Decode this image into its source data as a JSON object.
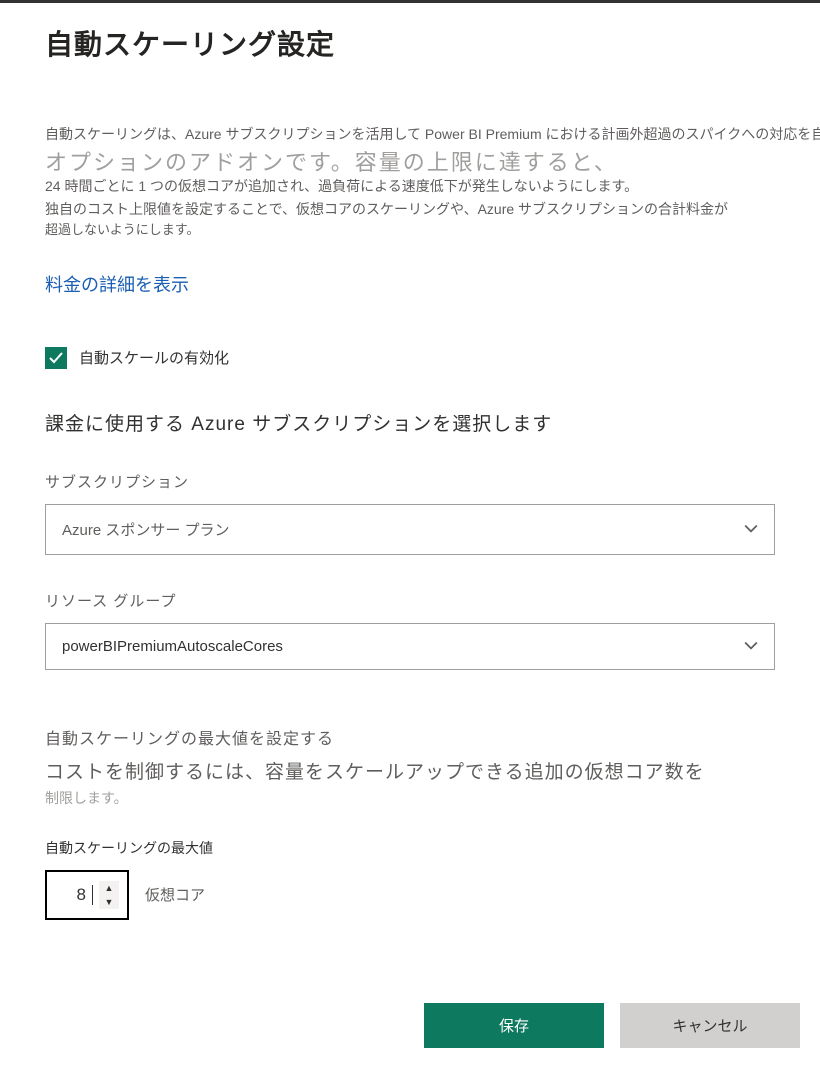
{
  "header": {
    "title": "自動スケーリング設定"
  },
  "description": {
    "line1": "自動スケーリングは、Azure サブスクリプションを活用して Power BI Premium における計画外超過のスパイクへの対応を自",
    "overlay": "オプションのアドオンです。容量の上限に達すると、",
    "line2": "24 時間ごとに 1 つの仮想コアが追加され、過負荷による速度低下が発生しないようにします。",
    "line3": "独自のコスト上限値を設定することで、仮想コアのスケーリングや、Azure サブスクリプションの合計料金が",
    "line4": "超過しないようにします。"
  },
  "links": {
    "show_pricing": "料金の詳細を表示"
  },
  "autoscale": {
    "enable_label": "自動スケールの有効化",
    "enabled": true
  },
  "subscription": {
    "section_title": "課金に使用する Azure サブスクリプションを選択します",
    "label": "サブスクリプション",
    "value": "Azure スポンサー プラン"
  },
  "resource_group": {
    "label": "リソース グループ",
    "value": "powerBIPremiumAutoscaleCores"
  },
  "max_section": {
    "set_max_label": "自動スケーリングの最大値を設定する",
    "description": "コストを制御するには、容量をスケールアップできる追加の仮想コア数を",
    "description2": "制限します。",
    "input_label": "自動スケーリングの最大値",
    "value": "8",
    "unit": "仮想コア"
  },
  "buttons": {
    "save": "保存",
    "cancel": "キャンセル"
  }
}
